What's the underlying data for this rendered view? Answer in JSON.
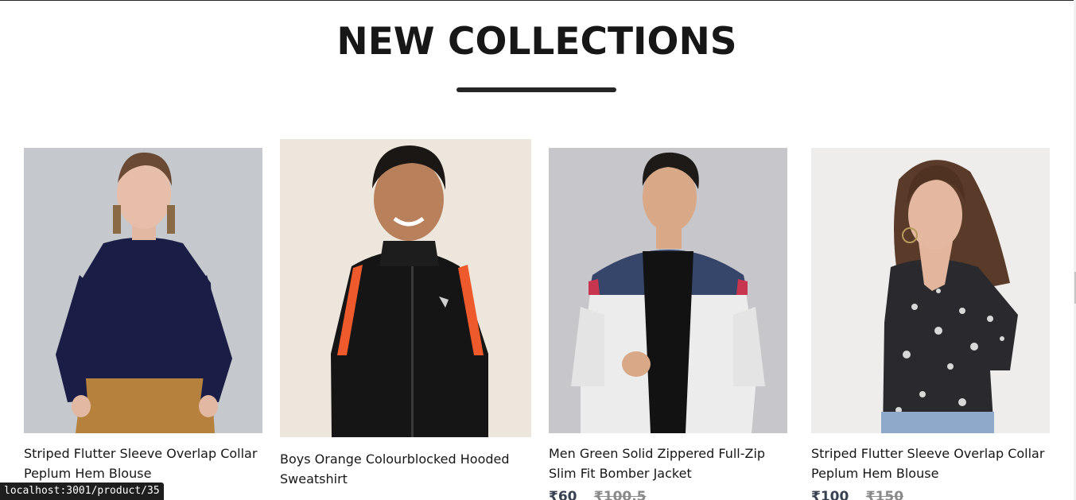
{
  "section": {
    "title": "NEW COLLECTIONS"
  },
  "products": [
    {
      "name": "Striped Flutter Sleeve Overlap Collar Peplum Hem Blouse",
      "image_icon": "woman-navy-top-photo",
      "price_new": "",
      "price_old": ""
    },
    {
      "name": "Boys Orange Colourblocked Hooded Sweatshirt",
      "image_icon": "boy-black-jacket-photo",
      "price_new": "",
      "price_old": ""
    },
    {
      "name": "Men Green Solid Zippered Full-Zip Slim Fit Bomber Jacket",
      "image_icon": "man-white-bomber-photo",
      "price_new": "₹60",
      "price_old": "₹100.5"
    },
    {
      "name": "Striped Flutter Sleeve Overlap Collar Peplum Hem Blouse",
      "image_icon": "woman-floral-blouse-photo",
      "price_new": "₹100",
      "price_old": "₹150"
    }
  ],
  "status_bar": {
    "url": "localhost:3001/product/35"
  }
}
